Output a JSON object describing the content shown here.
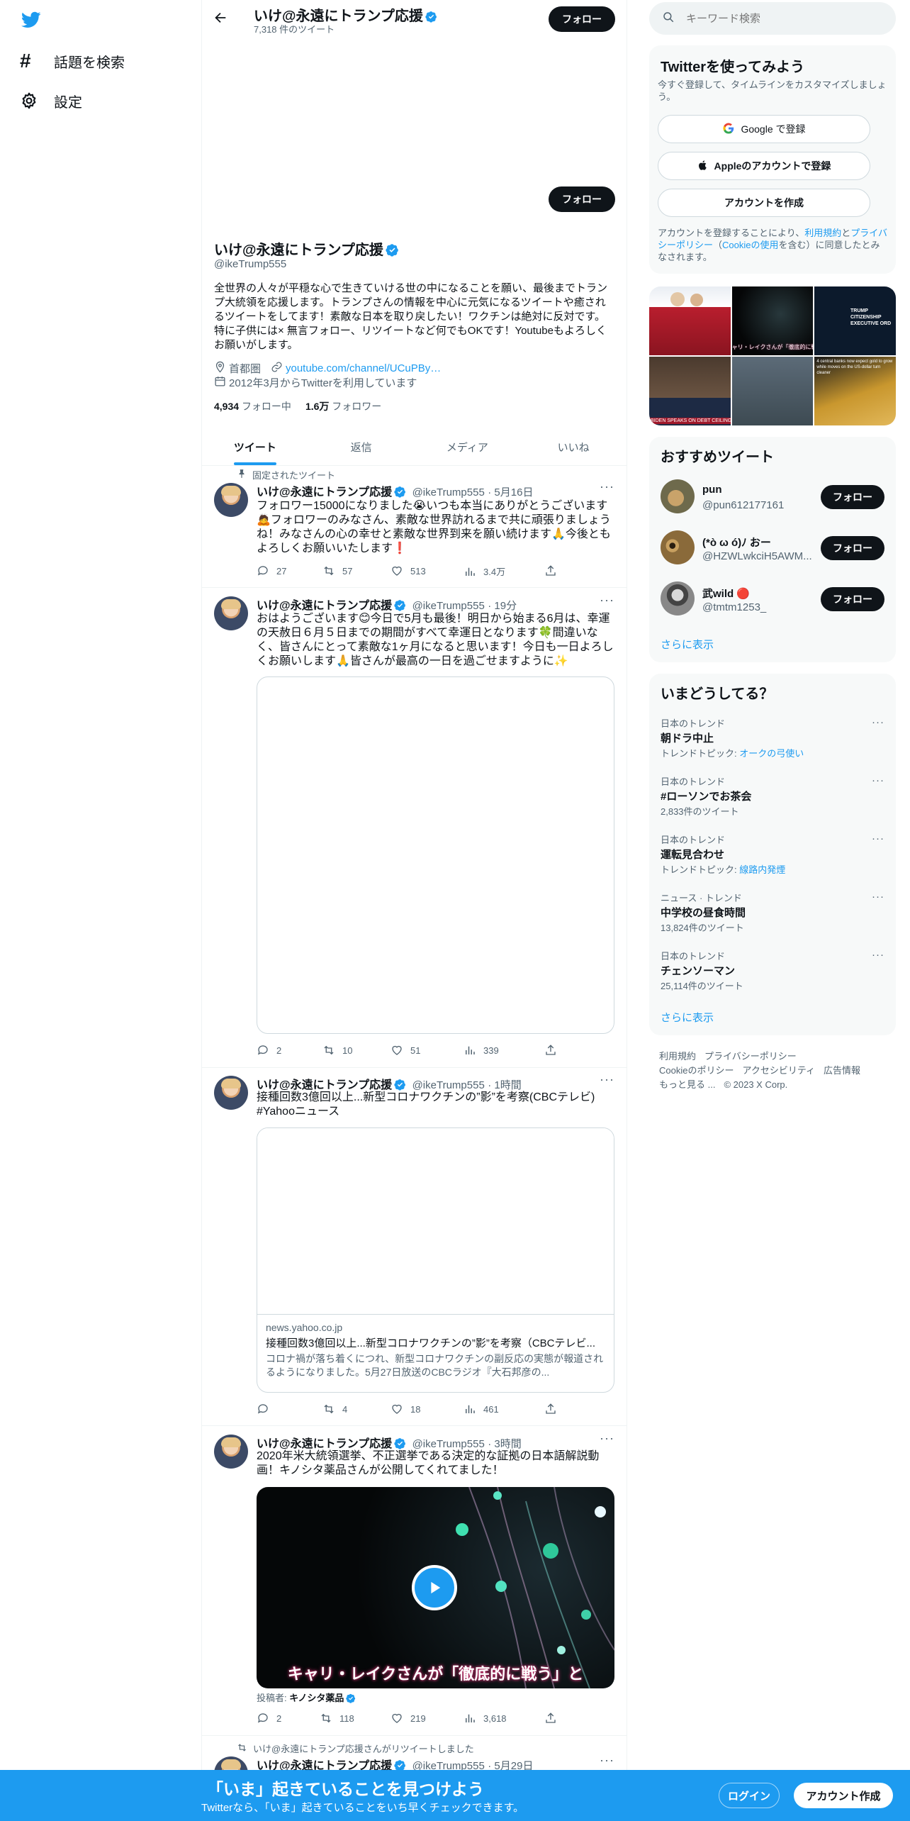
{
  "colors": {
    "accent": "#1d9bf0",
    "dark": "#0f1419",
    "gray": "#536471",
    "border": "#eff3f4",
    "panel": "#f7f9f9",
    "verified": "#1d9bf0"
  },
  "nav": {
    "explore_label": "話題を検索",
    "settings_label": "設定"
  },
  "header": {
    "name": "いけ@永遠にトランプ応援",
    "tweet_count": "7,318 件のツイート",
    "follow_label": "フォロー"
  },
  "profile": {
    "follow_label": "フォロー",
    "name": "いけ@永遠にトランプ応援",
    "handle": "@ikeTrump555",
    "bio": "全世界の人々が平穏な心で生きていける世の中になることを願い、最後までトランプ大統領を応援します。トランプさんの情報を中心に元気になるツイートや癒されるツイートをしてます！素敵な日本を取り戻したい！ワクチンは絶対に反対です。特に子供には× 無言フォロー、リツイートなど何でもOKです！Youtubeもよろしくお願いがします。",
    "location": "首都圏",
    "url": "youtube.com/channel/UCuPBy…",
    "joined": "2012年3月からTwitterを利用しています",
    "following_count": "4,934",
    "following_label": "フォロー中",
    "followers_count": "1.6万",
    "followers_label": "フォロワー"
  },
  "tabs": [
    "ツイート",
    "返信",
    "メディア",
    "いいね"
  ],
  "tweets": [
    {
      "pinned_label": "固定されたツイート",
      "name": "いけ@永遠にトランプ応援",
      "handle": "@ikeTrump555",
      "time": "· 5月16日",
      "text": "フォロワー15000になりました😭いつも本当にありがとうございます🙇フォロワーのみなさん、素敵な世界訪れるまで共に頑張りましょうね！みなさんの心の幸せと素敵な世界到来を願い続けます🙏今後ともよろしくお願いいたします❗",
      "replies": "27",
      "retweets": "57",
      "likes": "513",
      "views": "3.4万"
    },
    {
      "name": "いけ@永遠にトランプ応援",
      "handle": "@ikeTrump555",
      "time": "· 19分",
      "text": "おはようございます😊今日で5月も最後！明日から始まる6月は、幸運の天赦日６月５日までの期間がすべて幸運日となります🍀間違いなく、皆さんにとって素敵な1ヶ月になると思います！今日も一日よろしくお願いします🙏皆さんが最高の一日を過ごせますように✨",
      "replies": "2",
      "retweets": "10",
      "likes": "51",
      "views": "339"
    },
    {
      "name": "いけ@永遠にトランプ応援",
      "handle": "@ikeTrump555",
      "time": "· 1時間",
      "text": "接種回数3億回以上...新型コロナワクチンの”影”を考察(CBCテレビ)",
      "hashtag": "#Yahooニュース",
      "card_domain": "news.yahoo.co.jp",
      "card_title": "接種回数3億回以上...新型コロナワクチンの”影”を考察（CBCテレビ...",
      "card_desc": "コロナ禍が落ち着くにつれ、新型コロナワクチンの副反応の実態が報道されるようになりました。5月27日放送のCBCラジオ『大石邦彦の...",
      "replies": "",
      "retweets": "4",
      "likes": "18",
      "views": "461"
    },
    {
      "name": "いけ@永遠にトランプ応援",
      "handle": "@ikeTrump555",
      "time": "· 3時間",
      "text": "2020年米大統領選挙、不正選挙である決定的な証拠の日本語解説動画！キノシタ薬品さんが公開してくれてました！",
      "video_caption": "キャリ・レイクさんが「徹底的に戦う」と",
      "poster_label": "投稿者:",
      "poster_name": "キノシタ薬品",
      "replies": "2",
      "retweets": "118",
      "likes": "219",
      "views": "3,618"
    },
    {
      "retweet_label": "いけ@永遠にトランプ応援さんがリツイートしました",
      "name": "いけ@永遠にトランプ応援",
      "handle": "@ikeTrump555",
      "time": "· 5月29日"
    }
  ],
  "search": {
    "placeholder": "キーワード検索"
  },
  "signup": {
    "title": "Twitterを使ってみよう",
    "subtitle": "今すぐ登録して、タイムラインをカスタマイズしましょう。",
    "google_label": "Google で登録",
    "apple_label": "Appleのアカウントで登録",
    "create_label": "アカウントを作成",
    "terms_prefix": "アカウントを登録することにより、",
    "terms_link": "利用規約",
    "terms_and": "と",
    "privacy_link": "プライバシーポリシー",
    "terms_paren_open": "（",
    "cookie_link": "Cookieの使用",
    "terms_suffix": "を含む）に同意したとみなされます。"
  },
  "media_grid": {
    "thumb_caption_1": "ャリ・レイクさんが「徹底的に戦う」",
    "thumb_caption_2": "BIDEN SPEAKS ON DEBT CEILING D",
    "thumb_caption_3": "4 central banks now expect gold to grow while moves on the US-dollar turn cleaner",
    "thumb_caption_4": "TRUMP CITIZENSHIP EXECUTIVE ORD"
  },
  "recommended": {
    "title": "おすすめツイート",
    "users": [
      {
        "name": "pun",
        "handle": "@pun612177161",
        "follow_label": "フォロー"
      },
      {
        "name": "(*ò ω ó)ﾉ おー",
        "handle": "@HZWLwkciH5AWM...",
        "follow_label": "フォロー"
      },
      {
        "name": "武wild 🔴",
        "handle": "@tmtm1253_",
        "follow_label": "フォロー"
      }
    ],
    "more_label": "さらに表示"
  },
  "trends": {
    "title": "いまどうしてる？",
    "items": [
      {
        "meta": "日本のトレンド",
        "name": "朝ドラ中止",
        "sub_prefix": "トレンドトピック: ",
        "sub_link": "オークの弓使い"
      },
      {
        "meta": "日本のトレンド",
        "name": "#ローソンでお茶会",
        "sub_prefix": "2,833件のツイート",
        "sub_link": ""
      },
      {
        "meta": "日本のトレンド",
        "name": "運転見合わせ",
        "sub_prefix": "トレンドトピック: ",
        "sub_link": "線路内発煙"
      },
      {
        "meta": "ニュース · トレンド",
        "name": "中学校の昼食時間",
        "sub_prefix": "13,824件のツイート",
        "sub_link": ""
      },
      {
        "meta": "日本のトレンド",
        "name": "チェンソーマン",
        "sub_prefix": "25,114件のツイート",
        "sub_link": ""
      }
    ],
    "more_label": "さらに表示"
  },
  "footer": {
    "links": [
      "利用規約",
      "プライバシーポリシー",
      "Cookieのポリシー",
      "アクセシビリティ",
      "広告情報",
      "もっと見る ...",
      "© 2023 X Corp."
    ]
  },
  "bottom_bar": {
    "title": "「いま」起きていることを見つけよう",
    "subtitle": "Twitterなら、「いま」起きていることをいち早くチェックできます。",
    "login_label": "ログイン",
    "signup_label": "アカウント作成"
  }
}
